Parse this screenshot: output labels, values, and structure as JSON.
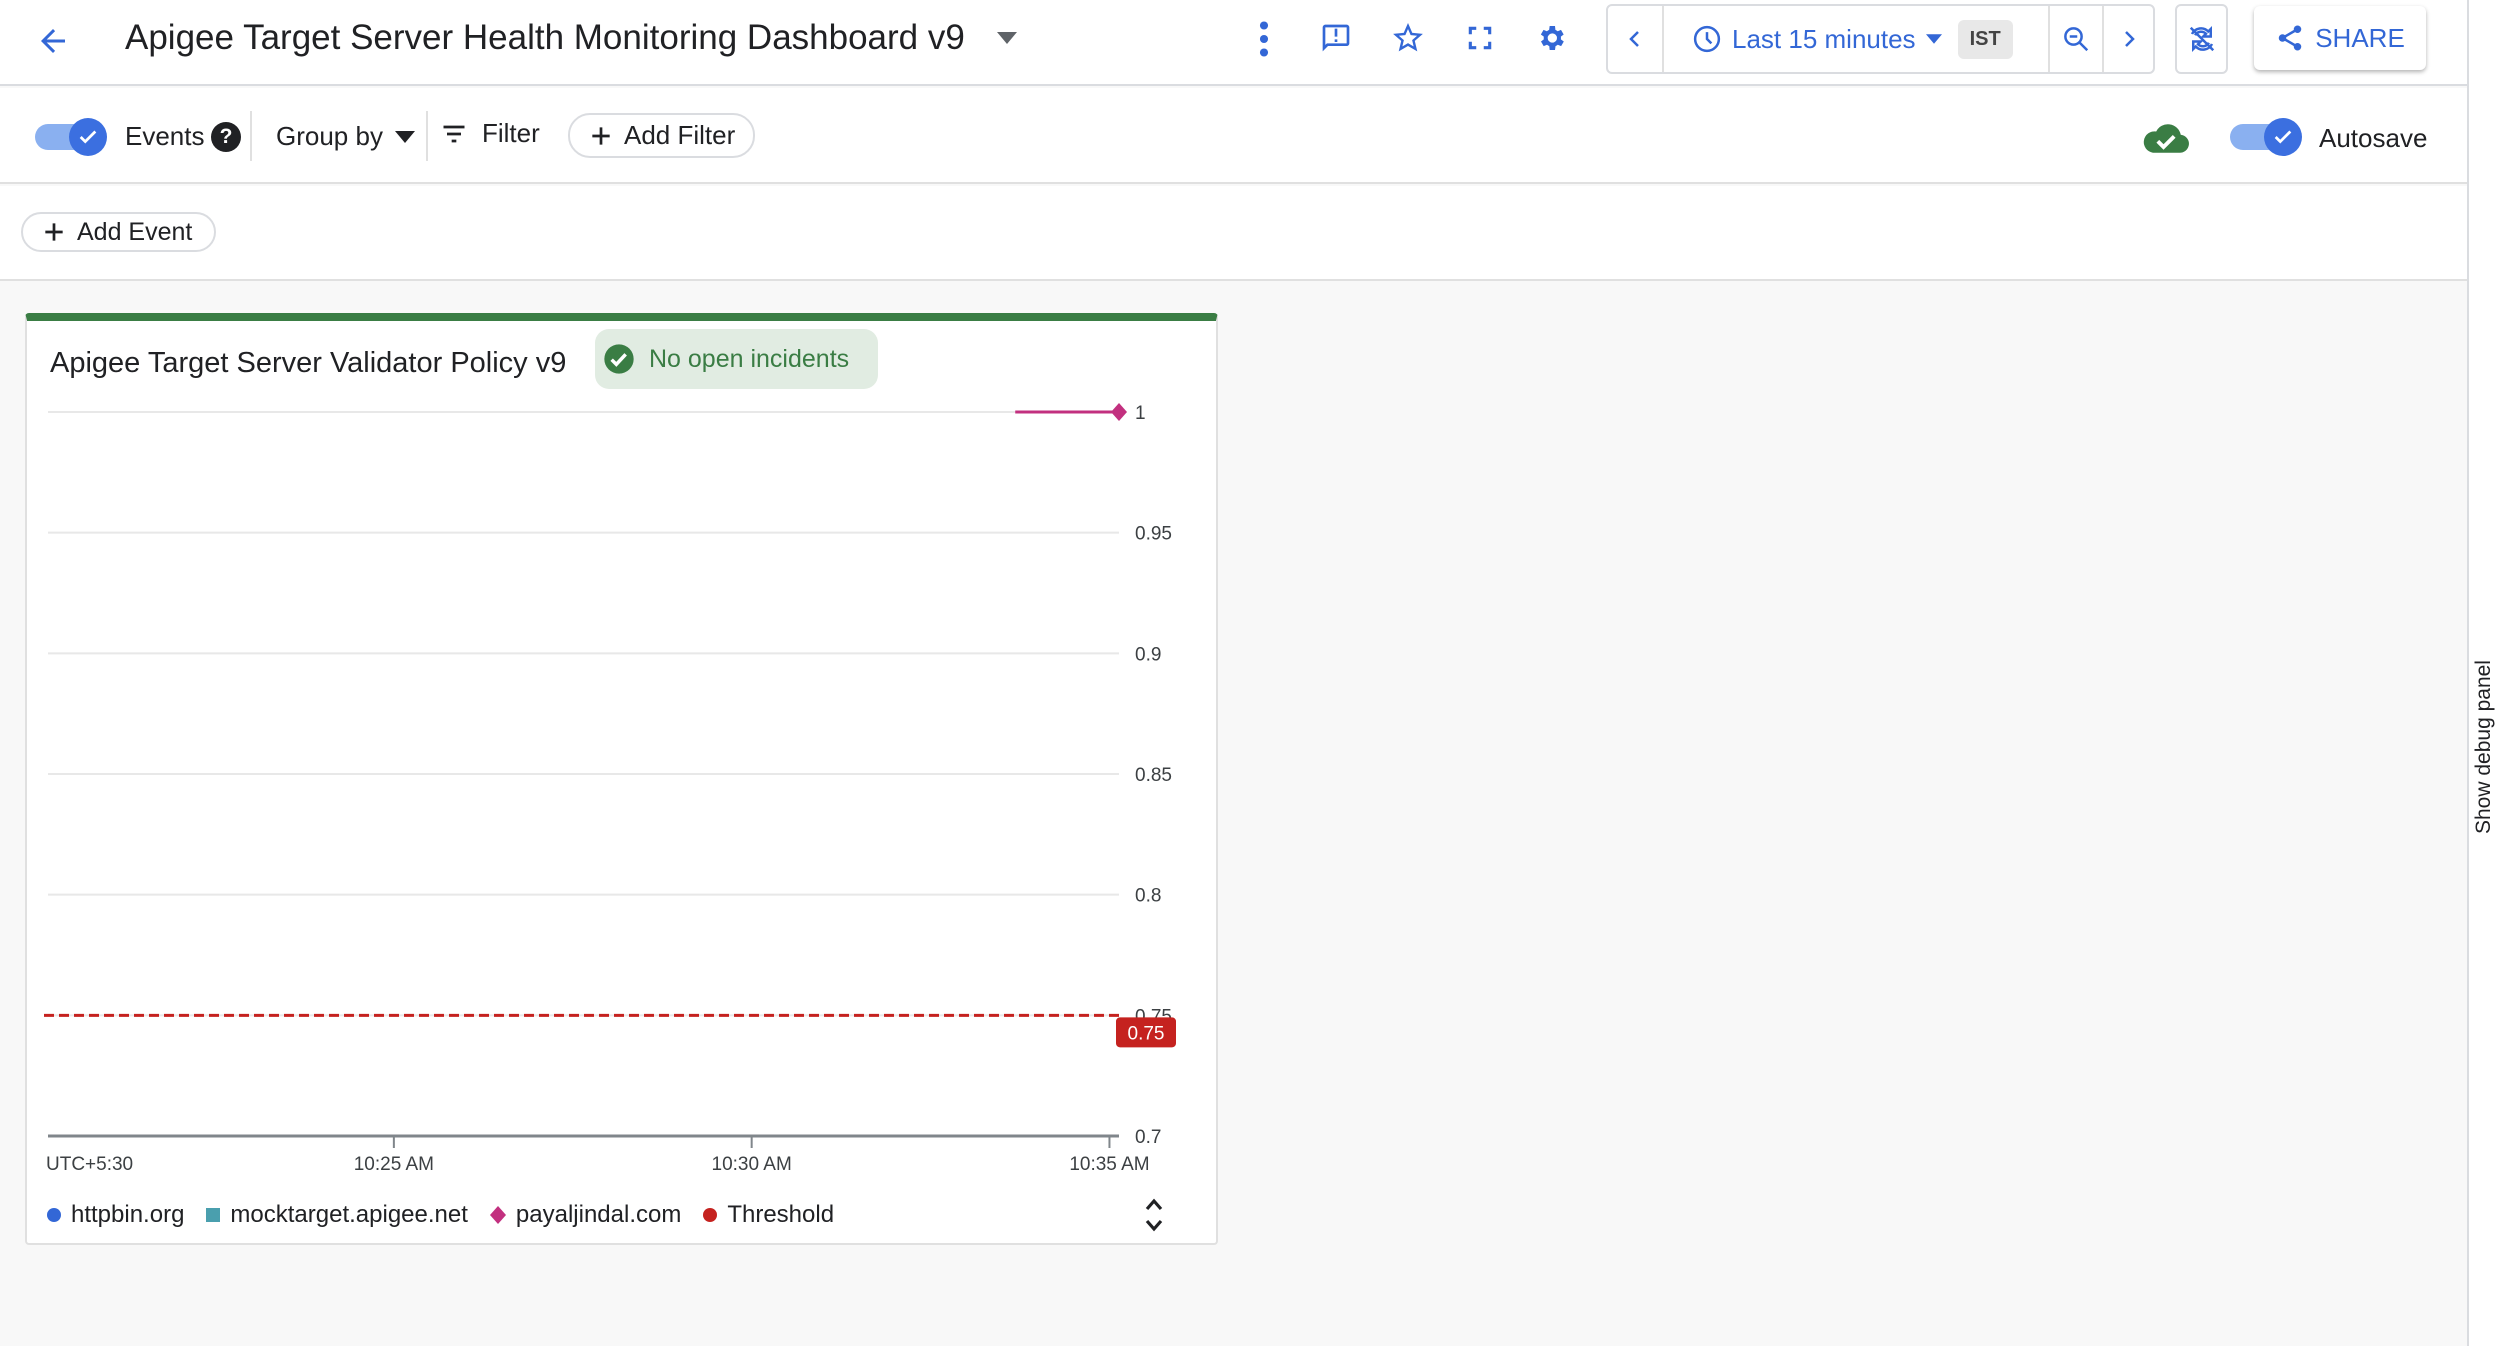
{
  "header": {
    "title": "Apigee Target Server Health Monitoring Dashboard v9",
    "time_range": "Last 15 minutes",
    "timezone": "IST",
    "share_label": "SHARE",
    "icons": [
      "back-arrow-icon",
      "dropdown-icon",
      "more-vert-icon",
      "feedback-icon",
      "star-icon",
      "fullscreen-icon",
      "settings-icon",
      "chevron-left-icon",
      "clock-icon",
      "zoom-out-icon",
      "chevron-right-icon",
      "sync-disabled-icon",
      "share-icon"
    ]
  },
  "toolbar": {
    "events_label": "Events",
    "events_enabled": true,
    "group_by_label": "Group by",
    "filter_label": "Filter",
    "add_filter_label": "Add Filter",
    "autosave_label": "Autosave",
    "autosave_enabled": true
  },
  "events": {
    "add_event_label": "Add Event"
  },
  "debug_panel": {
    "label": "Show debug panel"
  },
  "widget": {
    "title": "Apigee Target Server Validator Policy v9",
    "incident_status": "No open incidents",
    "accent_color": "#3a7d44"
  },
  "chart_data": {
    "type": "line",
    "title": "Apigee Target Server Validator Policy v9",
    "timezone_label": "UTC+5:30",
    "xlim": [
      "10:20:10",
      "10:35:08"
    ],
    "x_ticks": [
      {
        "t": "10:25:00",
        "label": "10:25 AM"
      },
      {
        "t": "10:30:00",
        "label": "10:30 AM"
      },
      {
        "t": "10:35:00",
        "label": "10:35 AM"
      }
    ],
    "ylim": [
      0.7,
      1
    ],
    "y_ticks": [
      "1",
      "0.95",
      "0.9",
      "0.85",
      "0.8",
      "0.75",
      "0.7"
    ],
    "grid": true,
    "legend_position": "bottom",
    "series": [
      {
        "name": "httpbin.org",
        "color": "#3367d6",
        "marker": "circle",
        "points": []
      },
      {
        "name": "mocktarget.apigee.net",
        "color": "#4a9fae",
        "marker": "square",
        "points": []
      },
      {
        "name": "payaljindal.com",
        "color": "#c2307f",
        "marker": "diamond",
        "points": [
          {
            "x": "10:33:41",
            "y": 1
          },
          {
            "x": "10:35:08",
            "y": 1
          }
        ]
      }
    ],
    "threshold": {
      "name": "Threshold",
      "value": 0.75,
      "label": "0.75",
      "color": "#c5221f"
    }
  }
}
